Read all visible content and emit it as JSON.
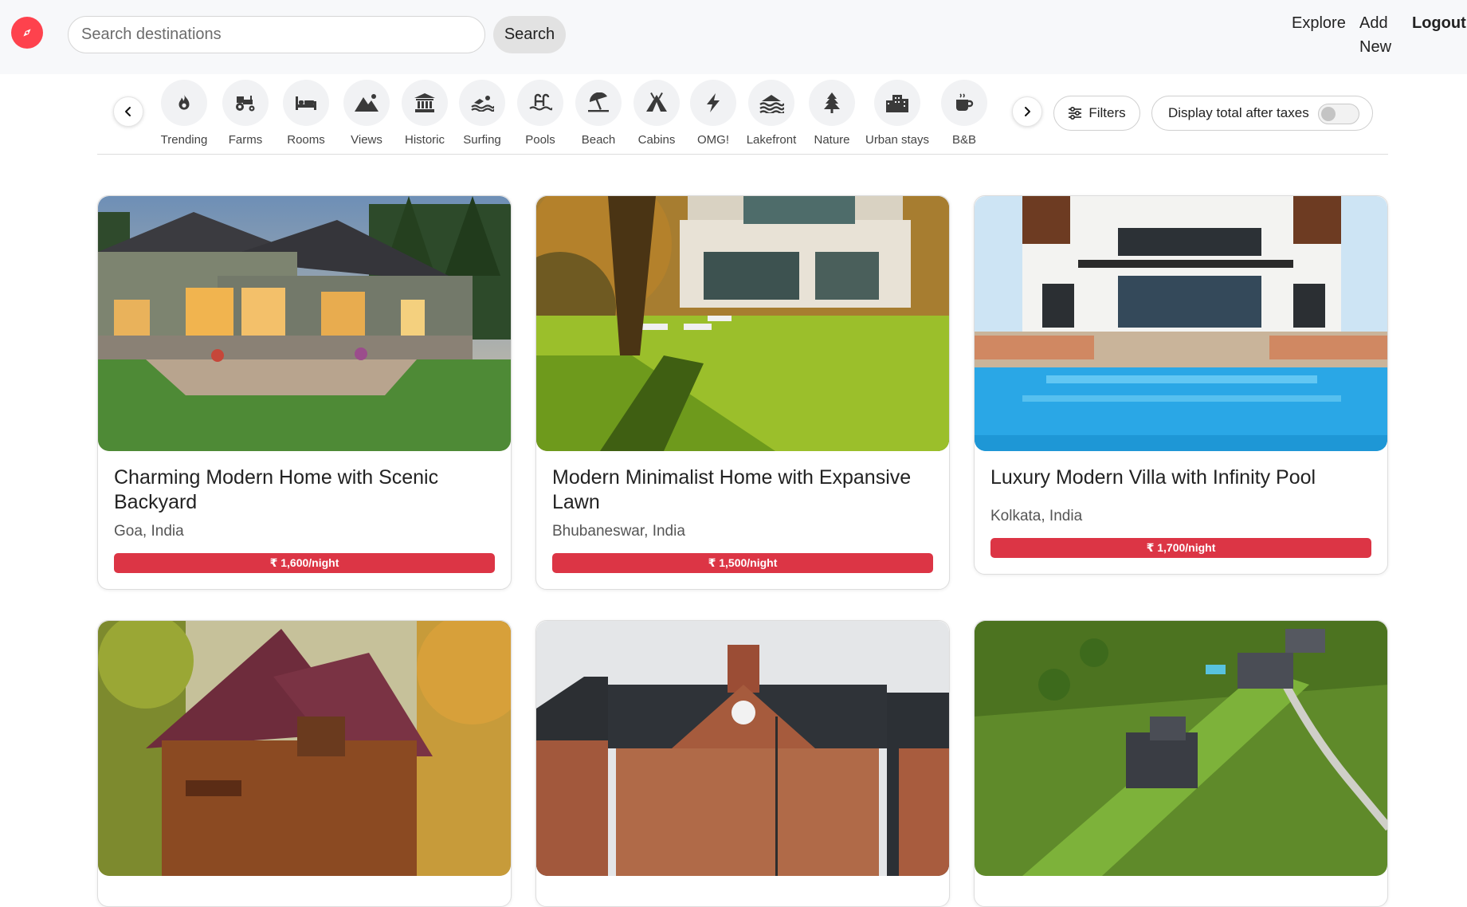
{
  "navbar": {
    "search_placeholder": "Search destinations",
    "search_button": "Search",
    "links": {
      "explore": "Explore",
      "add_new": "Add New",
      "logout": "Logout"
    }
  },
  "filters": {
    "items": [
      {
        "label": "Trending",
        "icon": "fire-icon"
      },
      {
        "label": "Farms",
        "icon": "tractor-icon"
      },
      {
        "label": "Rooms",
        "icon": "bed-icon"
      },
      {
        "label": "Views",
        "icon": "mountain-icon"
      },
      {
        "label": "Historic",
        "icon": "landmark-icon"
      },
      {
        "label": "Surfing",
        "icon": "swimmer-icon"
      },
      {
        "label": "Pools",
        "icon": "pool-icon"
      },
      {
        "label": "Beach",
        "icon": "umbrella-beach-icon"
      },
      {
        "label": "Cabins",
        "icon": "tent-icon"
      },
      {
        "label": "OMG!",
        "icon": "bolt-icon"
      },
      {
        "label": "Lakefront",
        "icon": "water-icon"
      },
      {
        "label": "Nature",
        "icon": "tree-icon"
      },
      {
        "label": "Urban stays",
        "icon": "city-icon"
      },
      {
        "label": "B&B",
        "icon": "mug-icon"
      }
    ],
    "filters_button": "Filters",
    "tax_toggle_label": "Display total after taxes",
    "tax_toggle_on": false
  },
  "listings": [
    {
      "title": "Charming Modern Home with Scenic Backyard",
      "location": "Goa, India",
      "price": "₹ 1,600/night"
    },
    {
      "title": "Modern Minimalist Home with Expansive Lawn",
      "location": "Bhubaneswar, India",
      "price": "₹ 1,500/night"
    },
    {
      "title": "Luxury Modern Villa with Infinity Pool",
      "location": "Kolkata, India",
      "price": "₹ 1,700/night"
    },
    {
      "title": "",
      "location": "",
      "price": ""
    },
    {
      "title": "",
      "location": "",
      "price": ""
    },
    {
      "title": "",
      "location": "",
      "price": ""
    }
  ],
  "colors": {
    "brand": "#fe424d",
    "price_badge": "#dc3545",
    "navbar_bg": "#f7f8fa"
  }
}
